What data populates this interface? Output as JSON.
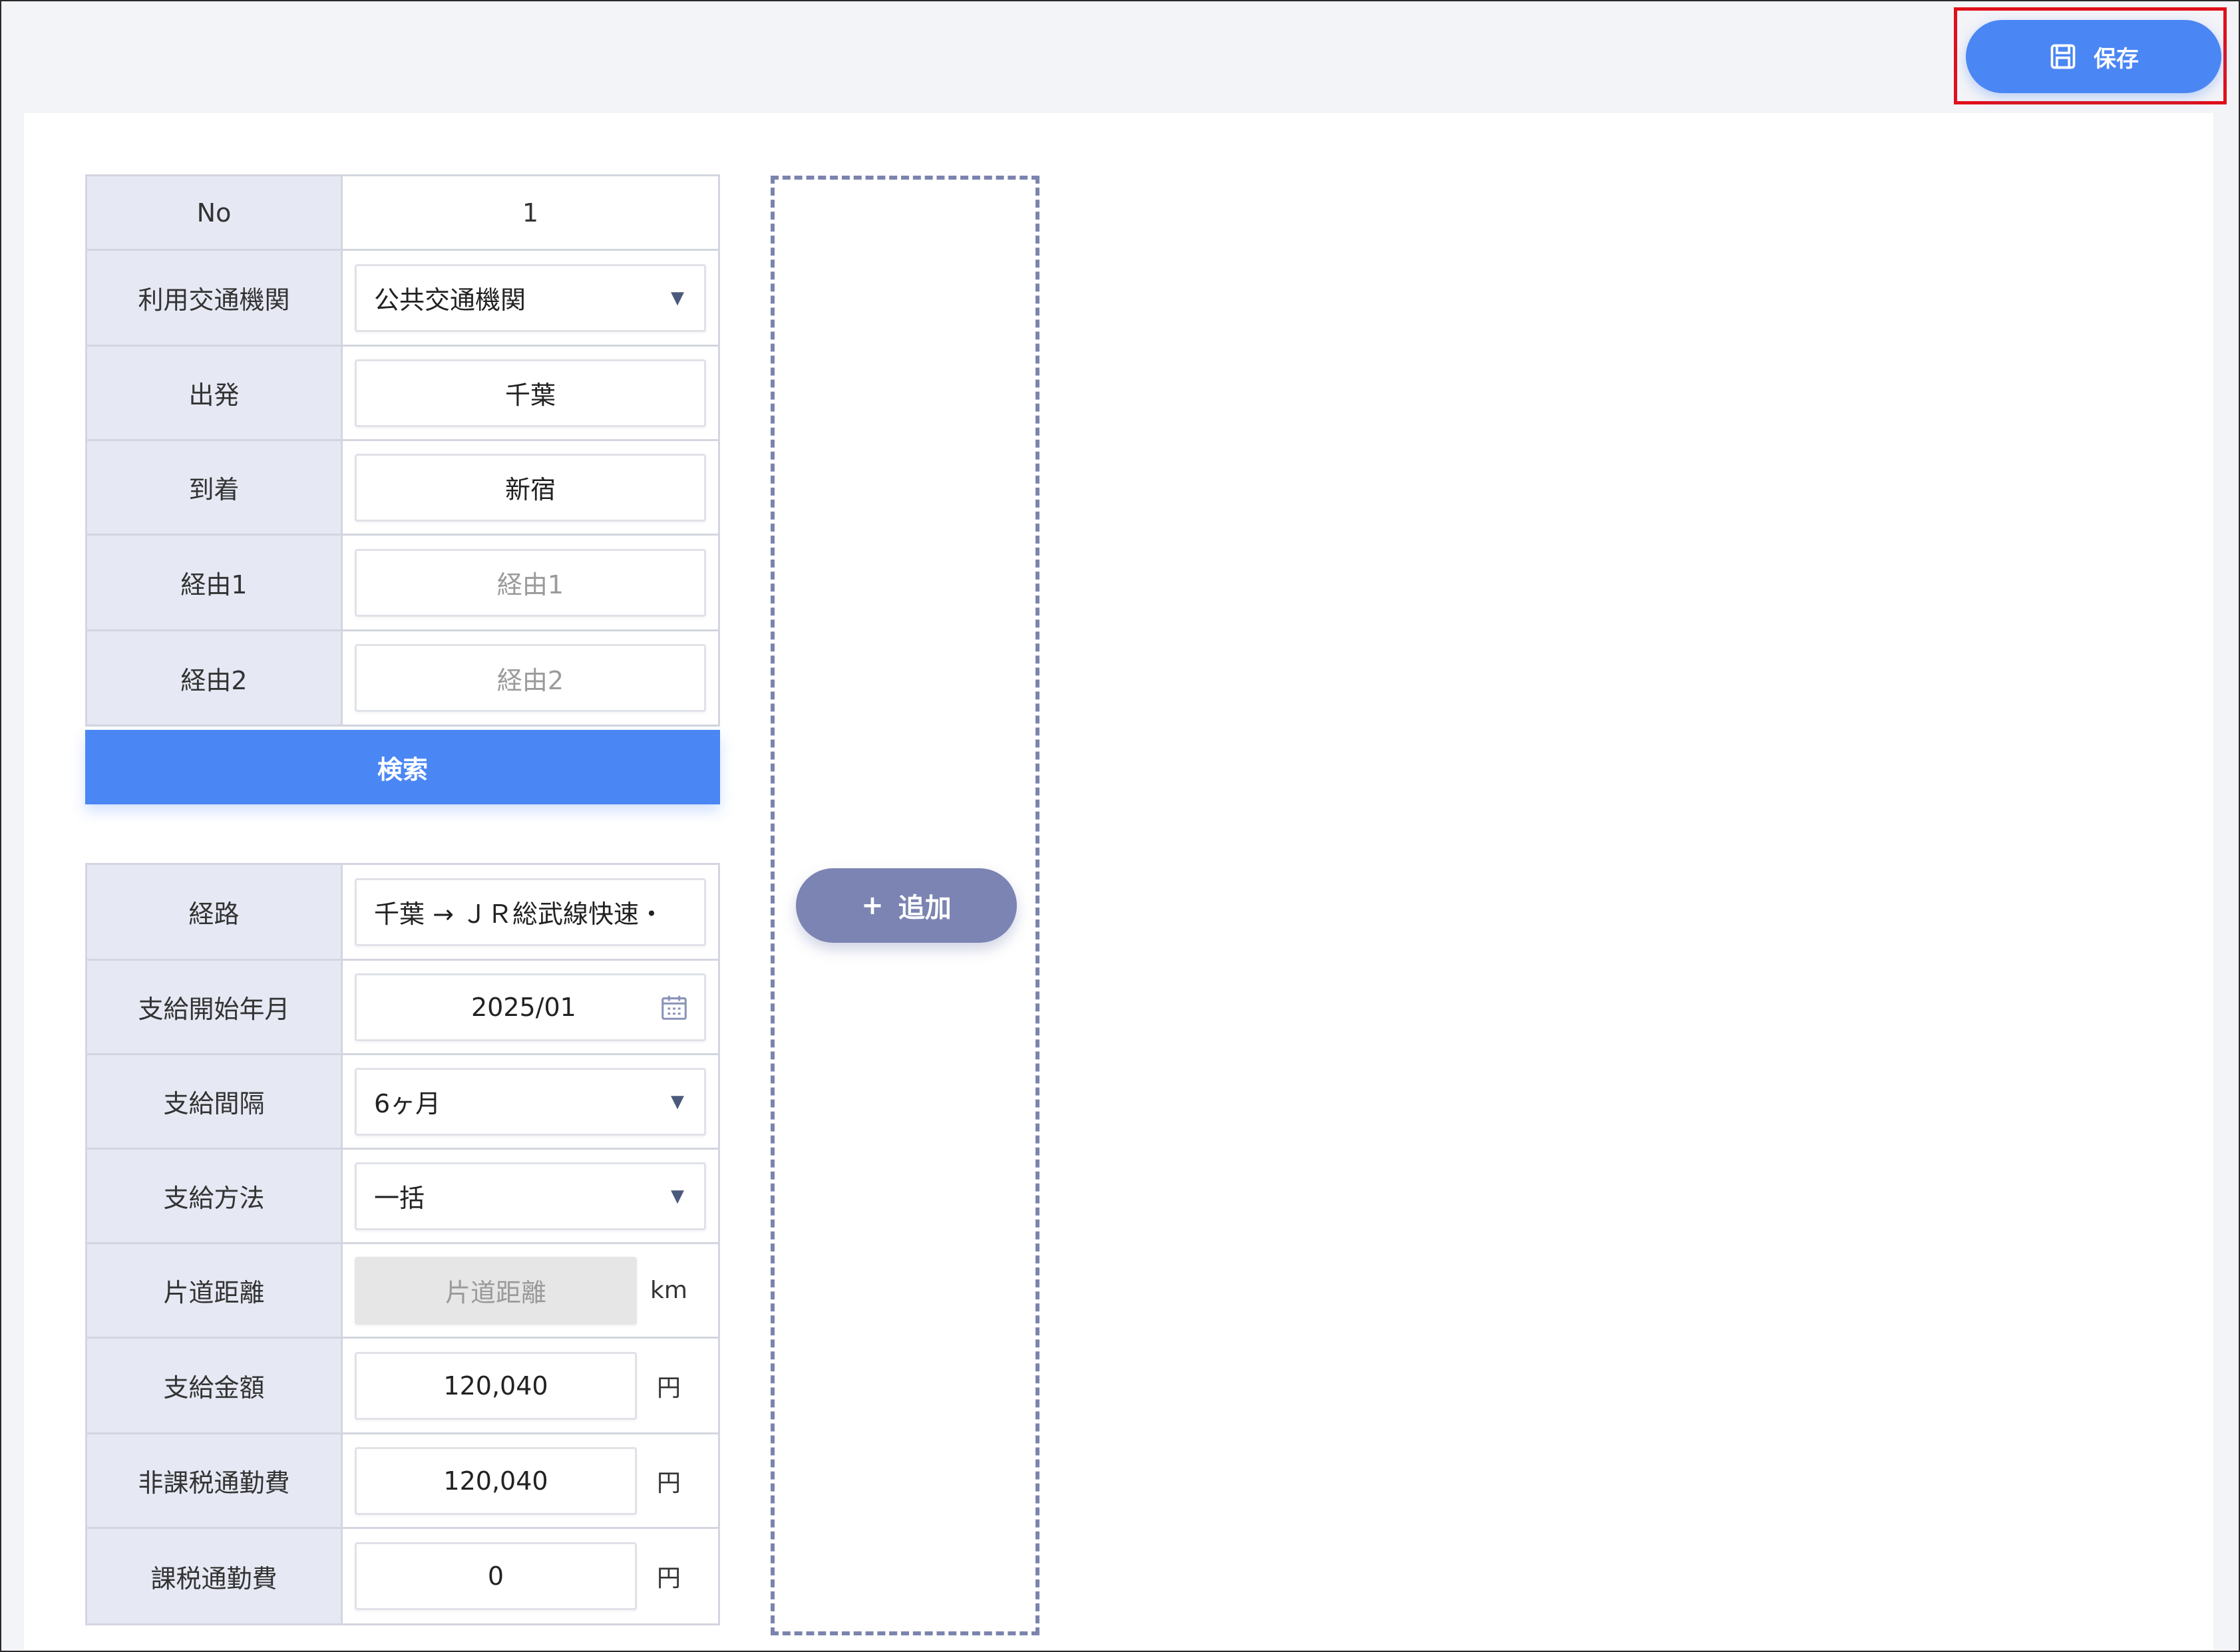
{
  "toolbar": {
    "save_label": "保存",
    "save_icon": "save-icon"
  },
  "form1": {
    "no_label": "No",
    "no_value": "1",
    "transport_label": "利用交通機関",
    "transport_value": "公共交通機関",
    "depart_label": "出発",
    "depart_value": "千葉",
    "arrive_label": "到着",
    "arrive_value": "新宿",
    "via1_label": "経由1",
    "via1_placeholder": "経由1",
    "via2_label": "経由2",
    "via2_placeholder": "経由2"
  },
  "search_label": "検索",
  "form2": {
    "route_label": "経路",
    "route_value": "千葉 → ＪＲ総武線快速・",
    "start_label": "支給開始年月",
    "start_value": "2025/01",
    "interval_label": "支給間隔",
    "interval_value": "6ヶ月",
    "method_label": "支給方法",
    "method_value": "一括",
    "distance_label": "片道距離",
    "distance_placeholder": "片道距離",
    "distance_unit": "km",
    "amount_label": "支給金額",
    "amount_value": "120,040",
    "amount_unit": "円",
    "nontax_label": "非課税通勤費",
    "nontax_value": "120,040",
    "nontax_unit": "円",
    "tax_label": "課税通勤費",
    "tax_value": "0",
    "tax_unit": "円"
  },
  "add_button": {
    "label": "追加",
    "icon": "+"
  },
  "colors": {
    "primary": "#4a86f4",
    "secondary": "#7b84b2",
    "highlight": "#e0101b",
    "label_bg": "#e6e9f4"
  }
}
